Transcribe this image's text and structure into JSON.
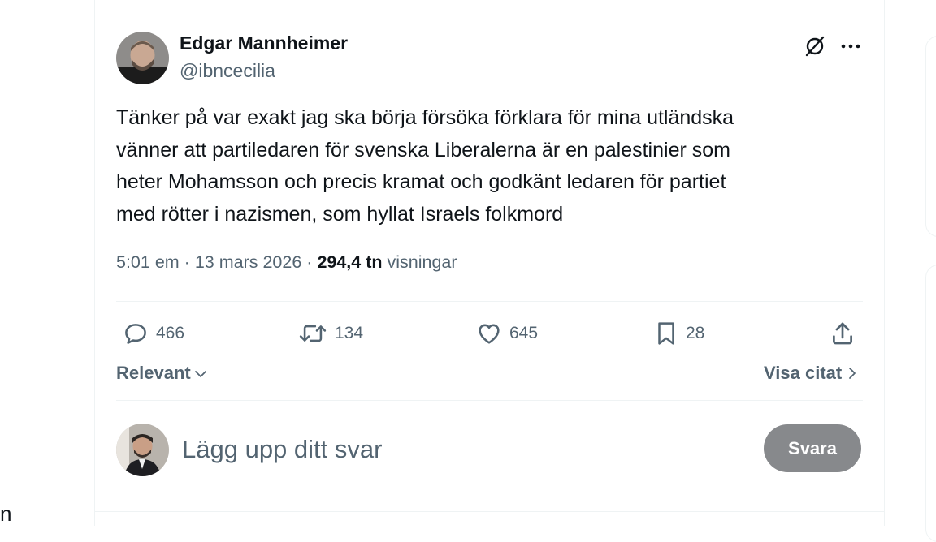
{
  "page_fragment": "n",
  "tweet": {
    "author_name": "Edgar Mannheimer",
    "author_handle": "@ibncecilia",
    "text_lines": [
      "Tänker på var exakt jag ska börja försöka förklara för mina utländska",
      "vänner att partiledaren för svenska Liberalerna är en palestinier som",
      "heter Mohamsson och precis kramat och godkänt ledaren för partiet",
      "med rötter i nazismen, som hyllat Israels folkmord"
    ],
    "time": "5:01 em",
    "separator": "·",
    "date": "13 mars 2026",
    "views_count": "294,4 tn",
    "views_label": "visningar"
  },
  "actions": {
    "replies": "466",
    "reposts": "134",
    "likes": "645",
    "bookmarks": "28"
  },
  "sort": {
    "relevant_label": "Relevant",
    "view_quotes_label": "Visa citat"
  },
  "reply": {
    "placeholder": "Lägg upp ditt svar",
    "button_label": "Svara"
  },
  "icons": {
    "grok": "grok-icon",
    "more": "more-icon",
    "reply": "reply-icon",
    "repost": "repost-icon",
    "like": "heart-icon",
    "bookmark": "bookmark-icon",
    "share": "share-icon",
    "chevron_down": "chevron-down-icon",
    "chevron_right": "chevron-right-icon"
  },
  "colors": {
    "text_primary": "#0f1419",
    "text_secondary": "#536471",
    "border": "#eff3f4",
    "reply_button_bg": "#87898c"
  }
}
